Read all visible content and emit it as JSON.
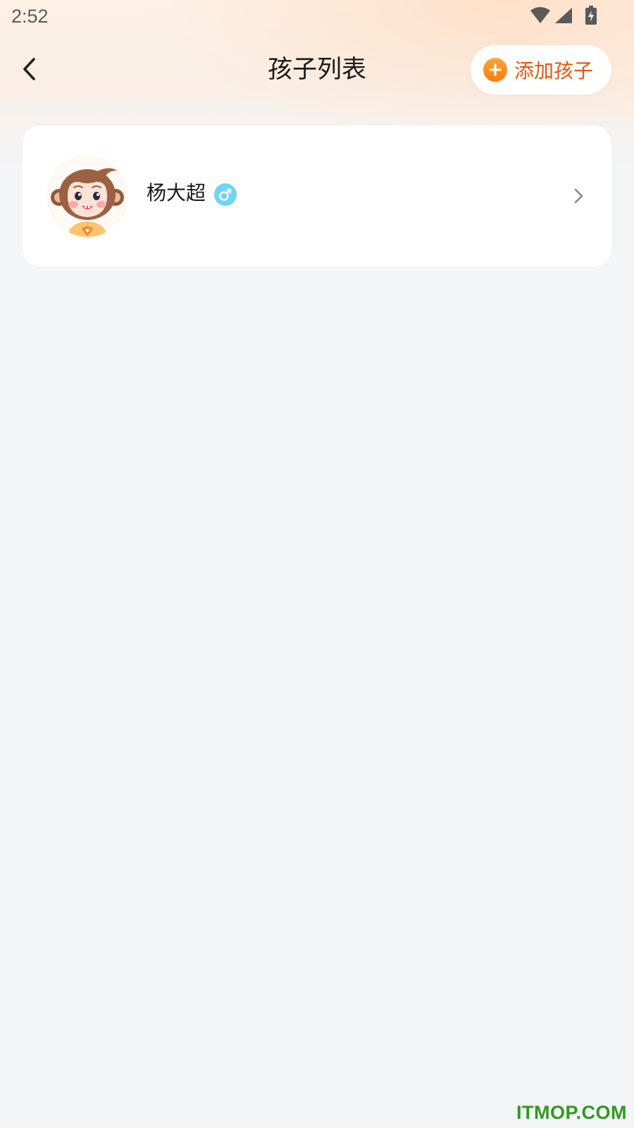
{
  "status_bar": {
    "time": "2:52",
    "icons": [
      "wifi-icon",
      "cellular-signal-icon",
      "battery-charging-icon"
    ]
  },
  "nav": {
    "title": "孩子列表",
    "back_icon": "chevron-left-icon",
    "add_button": {
      "label": "添加孩子",
      "icon": "plus-circle-icon"
    }
  },
  "children": [
    {
      "name": "杨大超",
      "gender_icon": "male-symbol-icon",
      "avatar": "monkey-avatar"
    }
  ],
  "watermark": "ITMOP.COM",
  "colors": {
    "accent": "#ff7a0a",
    "accent_text": "#e8560b",
    "gender_badge": "#6fd4f6",
    "background": "#f4f5f7",
    "card": "#ffffff",
    "watermark": "#2e9a1f"
  }
}
